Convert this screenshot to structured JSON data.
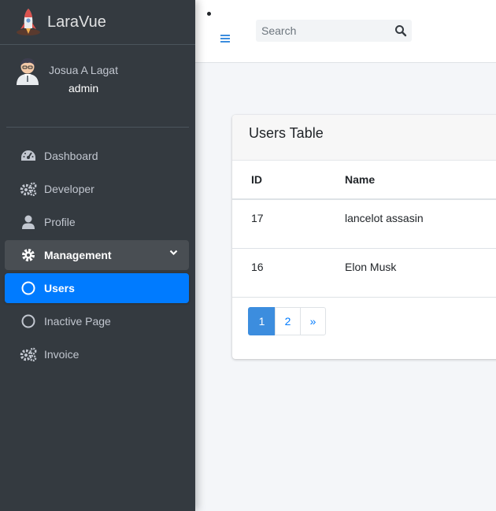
{
  "brand": {
    "name": "LaraVue"
  },
  "user": {
    "name": "Josua A Lagat",
    "role": "admin"
  },
  "nav": [
    {
      "label": "Dashboard",
      "icon": "tachometer-icon"
    },
    {
      "label": "Developer",
      "icon": "cogs-icon"
    },
    {
      "label": "Profile",
      "icon": "user-icon"
    },
    {
      "label": "Management",
      "icon": "cog-icon",
      "state": "open"
    },
    {
      "label": "Users",
      "icon": "circle-icon",
      "state": "active"
    },
    {
      "label": "Inactive Page",
      "icon": "circle-icon"
    },
    {
      "label": "Invoice",
      "icon": "cogs-icon"
    }
  ],
  "search": {
    "placeholder": "Search",
    "value": ""
  },
  "card": {
    "title": "Users Table",
    "columns": [
      "ID",
      "Name"
    ],
    "rows": [
      {
        "id": "17",
        "name": "lancelot assasin"
      },
      {
        "id": "16",
        "name": "Elon Musk"
      }
    ]
  },
  "pagination": {
    "pages": [
      "1",
      "2"
    ],
    "current": "1",
    "next": "»"
  },
  "colors": {
    "sidebar": "#343a40",
    "active": "#007bff",
    "page_active": "#3c8dde",
    "toggle": "#3c8dde"
  }
}
